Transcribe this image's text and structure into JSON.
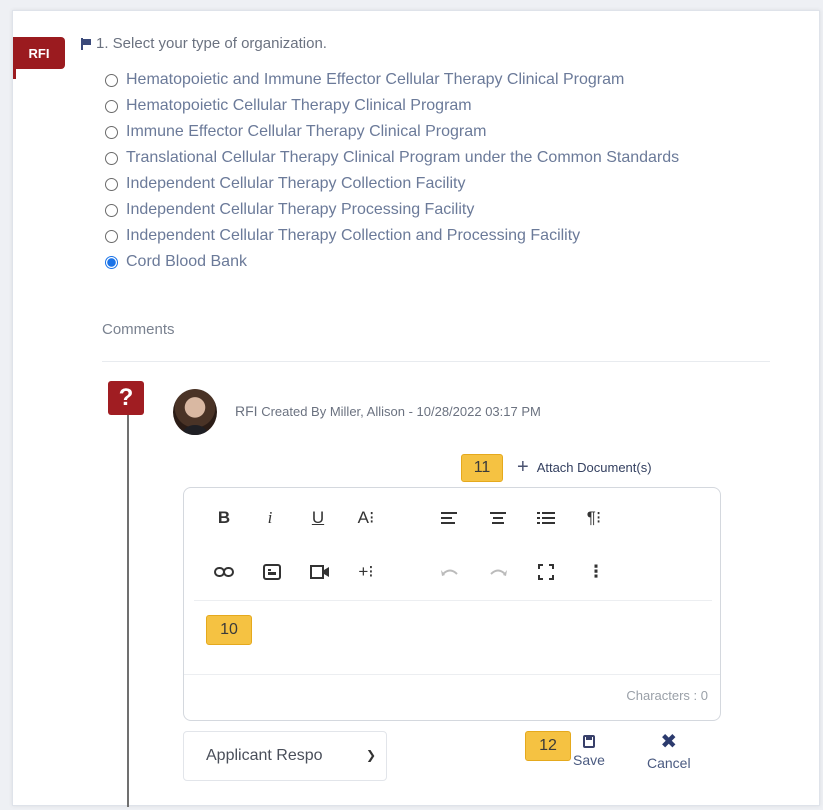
{
  "tag": {
    "label": "RFI"
  },
  "question": {
    "text": "1. Select your type of organization."
  },
  "options": [
    {
      "label": "Hematopoietic and Immune Effector Cellular Therapy Clinical Program",
      "checked": false
    },
    {
      "label": "Hematopoietic Cellular Therapy Clinical Program",
      "checked": false
    },
    {
      "label": "Immune Effector Cellular Therapy Clinical Program",
      "checked": false
    },
    {
      "label": "Translational Cellular Therapy Clinical Program under the Common Standards",
      "checked": false
    },
    {
      "label": "Independent Cellular Therapy Collection Facility",
      "checked": false
    },
    {
      "label": "Independent Cellular Therapy Processing Facility",
      "checked": false
    },
    {
      "label": "Independent Cellular Therapy Collection and Processing Facility",
      "checked": false
    },
    {
      "label": "Cord Blood Bank",
      "checked": true
    }
  ],
  "comments": {
    "label": "Comments"
  },
  "rfi_entry": {
    "badge": "?",
    "prefix": "RFI",
    "created_text": "Created By Miller, Allison - 10/28/2022 03:17 PM"
  },
  "callouts": {
    "attach": "11",
    "editor": "10",
    "save": "12"
  },
  "attach": {
    "label": "Attach Document(s)"
  },
  "toolbar": {
    "bold": "B",
    "italic": "i",
    "underline": "U",
    "font_size": "A⁝",
    "para": "¶⁝",
    "insert_more": "+⁝",
    "more": "⋮"
  },
  "editor": {
    "characters": "Characters : 0"
  },
  "status": {
    "selected": "Applicant Respo"
  },
  "actions": {
    "save": "Save",
    "cancel": "Cancel"
  },
  "colors": {
    "rfi_red": "#9b1b1f",
    "callout_yellow": "#f5c242",
    "radio_selected": "#1a73e8"
  }
}
